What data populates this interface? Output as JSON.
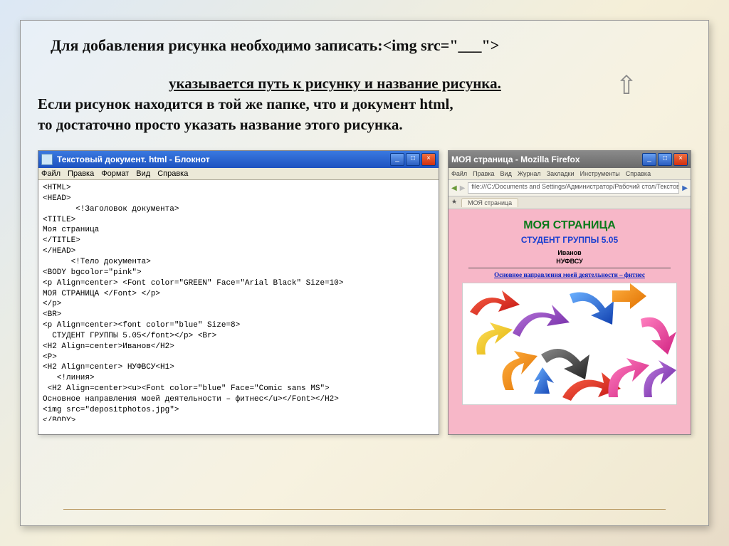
{
  "heading1": "Для добавления рисунка необходимо записать:<img src=\"___\">",
  "heading2_underlined": "указывается путь к рисунку и название рисунка.",
  "body_text_l1": "Если рисунок находится в той же папке, что и документ html,",
  "body_text_l2": "то достаточно просто указать название этого рисунка.",
  "notepad": {
    "title": "Текстовый документ. html - Блокнот",
    "menu": [
      "Файл",
      "Правка",
      "Формат",
      "Вид",
      "Справка"
    ],
    "code": "<HTML>\n<HEAD>\n       <!Заголовок документа>\n<TITLE>\nМоя страница\n</TITLE>\n</HEAD>\n      <!Тело документа>\n<BODY bgcolor=\"pink\">\n<p Align=center> <Font color=\"GREEN\" Face=\"Arial Black\" Size=10>\nМОЯ СТРАНИЦА </Font> </p>\n</p>\n<BR>\n<p Align=center><font color=\"blue\" Size=8>\n  СТУДЕНТ ГРУППЫ 5.05</font></p> <Br>\n<H2 Align=center>Иванов</H2>\n<P>\n<H2 Align=center> НУФВСУ<H1>\n   <!линия>\n <H2 Align=center><u><Font color=\"blue\" Face=\"Comic sans MS\">\nОсновное направления моей деятельности – фитнес</u></Font></H2>\n<img src=\"depositphotos.jpg\">\n</BODY>\n</HTML>"
  },
  "browser": {
    "title": "МОЯ страница - Mozilla Firefox",
    "toolbar": [
      "Файл",
      "Правка",
      "Вид",
      "Журнал",
      "Закладки",
      "Инструменты",
      "Справка"
    ],
    "address": "file:///C:/Documents and Settings/Администратор/Рабочий стол/Текстовый документ.html",
    "tab": "МОЯ страница",
    "page_h1": "МОЯ СТРАНИЦА",
    "page_h2": "СТУДЕНТ ГРУППЫ 5.05",
    "sub1": "Иванов",
    "sub2": "НУФВСУ",
    "link_text": "Основное направления моей деятельности – фитнес"
  }
}
